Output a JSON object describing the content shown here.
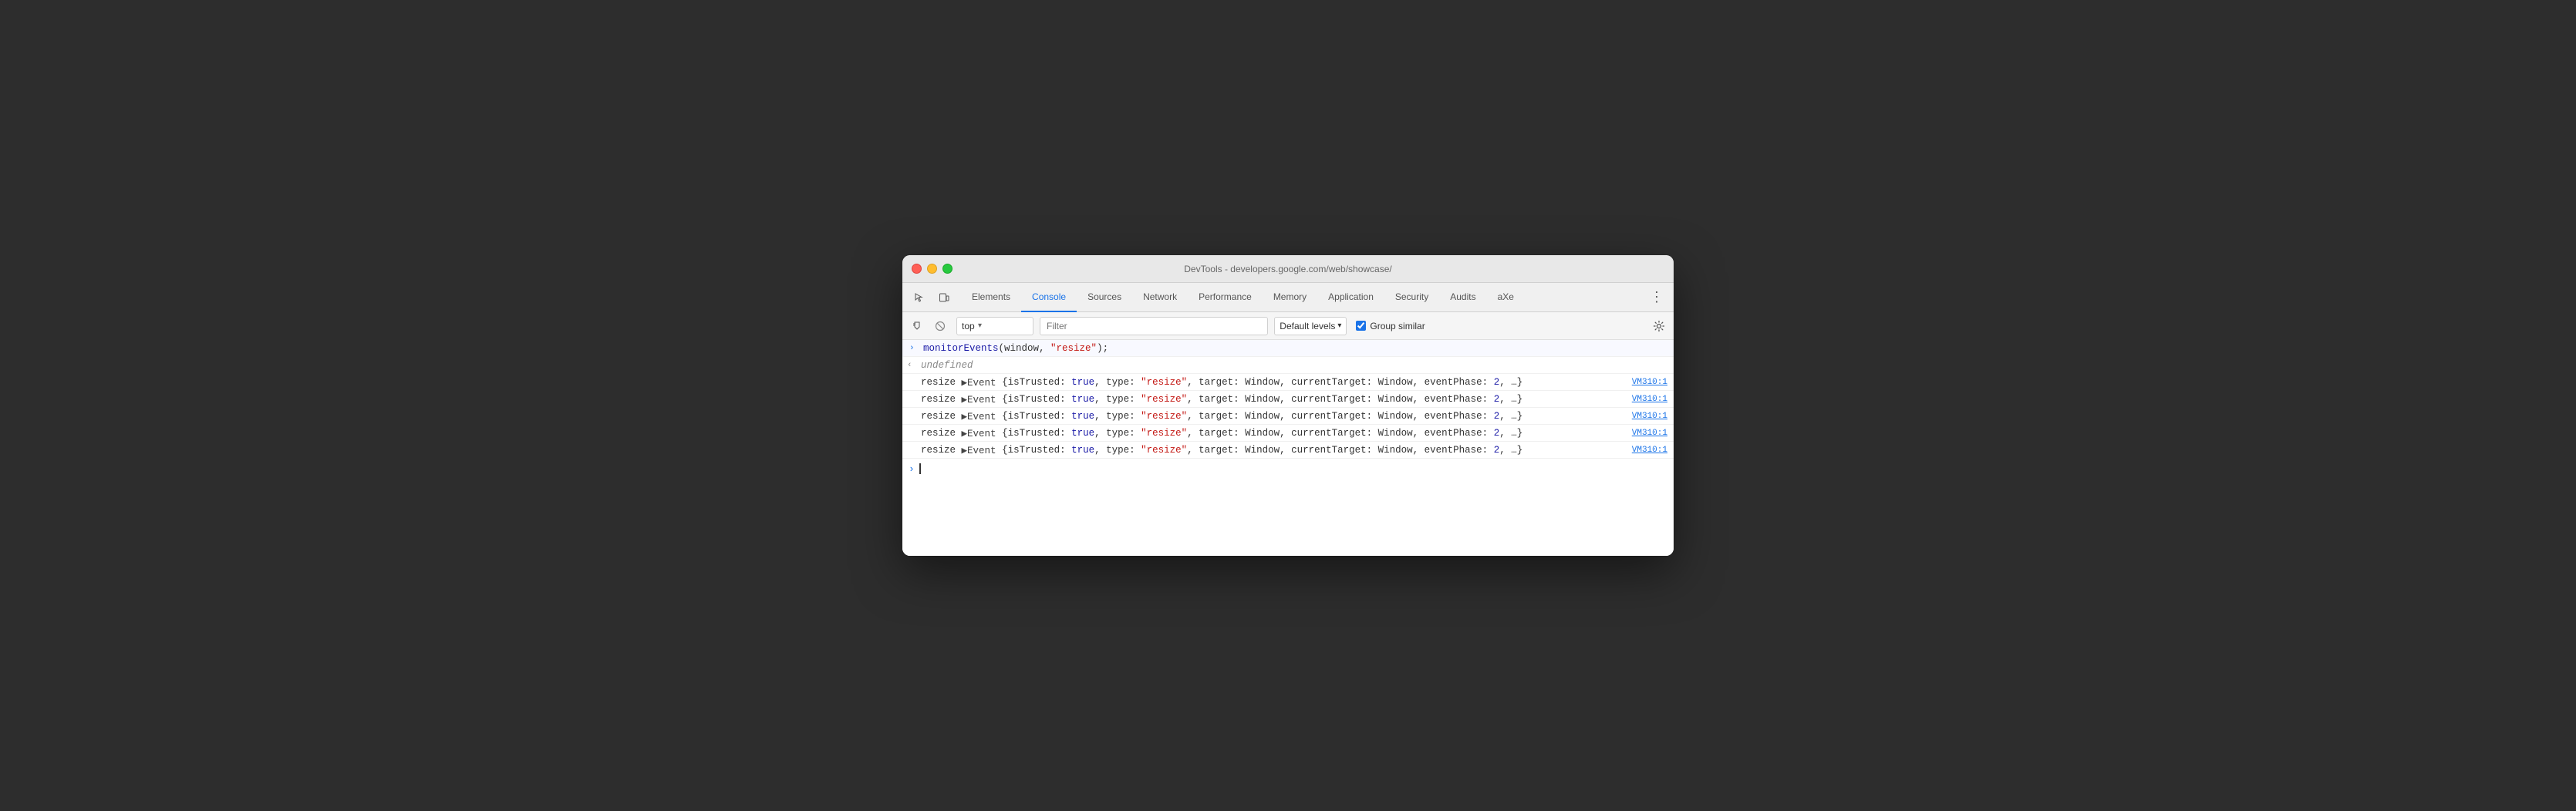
{
  "window": {
    "title": "DevTools - developers.google.com/web/showcase/"
  },
  "traffic_lights": {
    "red_label": "close",
    "yellow_label": "minimize",
    "green_label": "maximize"
  },
  "tabs": [
    {
      "id": "elements",
      "label": "Elements",
      "active": false
    },
    {
      "id": "console",
      "label": "Console",
      "active": true
    },
    {
      "id": "sources",
      "label": "Sources",
      "active": false
    },
    {
      "id": "network",
      "label": "Network",
      "active": false
    },
    {
      "id": "performance",
      "label": "Performance",
      "active": false
    },
    {
      "id": "memory",
      "label": "Memory",
      "active": false
    },
    {
      "id": "application",
      "label": "Application",
      "active": false
    },
    {
      "id": "security",
      "label": "Security",
      "active": false
    },
    {
      "id": "audits",
      "label": "Audits",
      "active": false
    },
    {
      "id": "axe",
      "label": "aXe",
      "active": false
    }
  ],
  "toolbar": {
    "filter_placeholder": "Filter",
    "levels_label": "Default levels",
    "group_similar_label": "Group similar",
    "group_similar_checked": true,
    "context_selector": "top"
  },
  "console": {
    "input_command": "monitorEvents(window, \"resize\");",
    "undefined_label": "undefined",
    "resize_rows": [
      {
        "label": "resize",
        "content": "▶Event {isTrusted: true, type: \"resize\", target: Window, currentTarget: Window, eventPhase: 2, …}",
        "source": "VM310:1"
      },
      {
        "label": "resize",
        "content": "▶Event {isTrusted: true, type: \"resize\", target: Window, currentTarget: Window, eventPhase: 2, …}",
        "source": "VM310:1"
      },
      {
        "label": "resize",
        "content": "▶Event {isTrusted: true, type: \"resize\", target: Window, currentTarget: Window, eventPhase: 2, …}",
        "source": "VM310:1"
      },
      {
        "label": "resize",
        "content": "▶Event {isTrusted: true, type: \"resize\", target: Window, currentTarget: Window, eventPhase: 2, …}",
        "source": "VM310:1"
      },
      {
        "label": "resize",
        "content": "▶Event {isTrusted: true, type: \"resize\", target: Window, currentTarget: Window, eventPhase: 2, …}",
        "source": "VM310:1"
      }
    ]
  },
  "icons": {
    "cursor_icon": "⬡",
    "device_icon": "⬜",
    "clear_icon": "🚫",
    "play_icon": "▶",
    "settings_icon": "⚙",
    "more_icon": "⋮",
    "expand_icon": "▶"
  }
}
